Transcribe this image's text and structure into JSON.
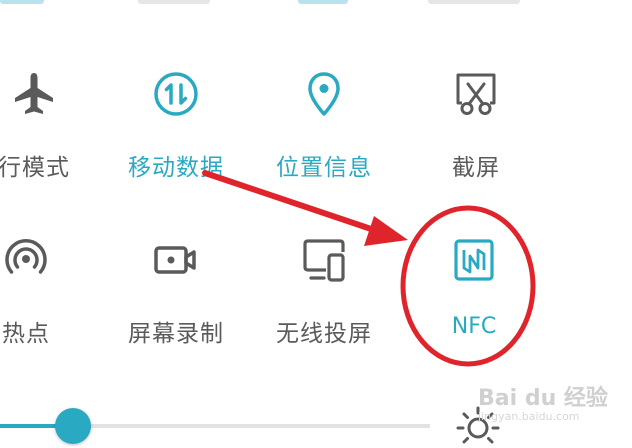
{
  "colors": {
    "accent": "#2aa9c3",
    "inactive": "#5a5a5a",
    "annotation": "#e0242b"
  },
  "row1": {
    "airplane_label": "行模式",
    "mobile_data_label": "移动数据",
    "location_label": "位置信息",
    "screenshot_label": "截屏"
  },
  "row2": {
    "hotspot_label": "热点",
    "screen_record_label": "屏幕录制",
    "wireless_projection_label": "无线投屏",
    "nfc_label": "NFC"
  },
  "brightness": {
    "level": 0.17
  },
  "watermark": {
    "logo_text": "Bai du 经验",
    "sub_text": "jingyan.baidu.com"
  }
}
